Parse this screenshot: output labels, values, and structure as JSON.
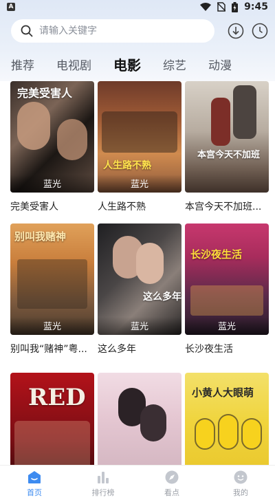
{
  "status_bar": {
    "time": "9:45",
    "app_indicator": "A"
  },
  "search": {
    "placeholder": "请输入关键字"
  },
  "header_icons": [
    "download-icon",
    "history-icon"
  ],
  "tabs": [
    {
      "label": "推荐",
      "active": false
    },
    {
      "label": "电视剧",
      "active": false
    },
    {
      "label": "电影",
      "active": true
    },
    {
      "label": "综艺",
      "active": false
    },
    {
      "label": "动漫",
      "active": false
    }
  ],
  "movies": [
    {
      "title": "完美受害人",
      "badge": "蓝光",
      "poster_text": "完美受害人"
    },
    {
      "title": "人生路不熟",
      "badge": "蓝光",
      "poster_text": "人生路不熟"
    },
    {
      "title": "本宫今天不加班...",
      "badge": "",
      "poster_text": "本宫今天不加班"
    },
    {
      "title": "别叫我“赌神”粤...",
      "badge": "蓝光",
      "poster_text": "别叫我赌神"
    },
    {
      "title": "这么多年",
      "badge": "蓝光",
      "poster_text": "这么多年"
    },
    {
      "title": "长沙夜生活",
      "badge": "蓝光",
      "poster_text": "长沙夜生活"
    },
    {
      "title": "",
      "badge": "",
      "poster_text": "RED"
    },
    {
      "title": "",
      "badge": "",
      "poster_text": ""
    },
    {
      "title": "",
      "badge": "",
      "poster_text": "小黄人大眼萌"
    }
  ],
  "bottom_nav": [
    {
      "label": "首页",
      "icon": "home-icon",
      "active": true
    },
    {
      "label": "排行榜",
      "icon": "ranking-icon",
      "active": false
    },
    {
      "label": "看点",
      "icon": "discover-icon",
      "active": false
    },
    {
      "label": "我的",
      "icon": "profile-icon",
      "active": false
    }
  ],
  "colors": {
    "accent": "#3d8bf0",
    "header_bg": "#e3ebf7"
  }
}
